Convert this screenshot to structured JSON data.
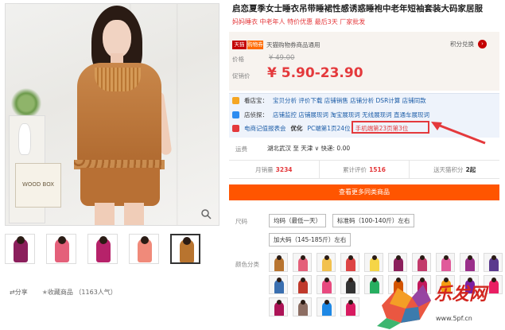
{
  "product": {
    "title": "启恋夏季女士睡衣吊带睡裙性感诱惑睡袍中老年短袖套装大码家居服",
    "subtitle": "妈妈睡衣 中老年人 特价优惠 最后3天 厂家批发",
    "badges": {
      "tmall": "天猫",
      "shopping": "购物券",
      "note": "天猫购物券商品通用"
    },
    "points_link": "积分兑换",
    "price_label": "价格",
    "original_price": "¥ 49.00",
    "promo_label": "促销价",
    "promo_price": "¥ 5.90-23.90"
  },
  "tools": {
    "row1": {
      "lead": "看店宝：",
      "text": "宝贝分析 评价下载 店铺销售 店铺分析 DSR计算 店铺同款"
    },
    "row2": {
      "lead": "店侦探：",
      "text": "店铺监控 店铺展现词 淘宝展现词 无线展现词 直通车展现词"
    },
    "row3": {
      "lead": "电商记值报表会",
      "tag": "优化",
      "pc": "PC端第1页24位",
      "mobile": "手机端第23页第3位"
    }
  },
  "shipping": {
    "label": "运费",
    "text": "湖北武汉 至 天津 ∨ 快递: 0.00"
  },
  "stats": [
    {
      "label": "月销量",
      "value": "3234"
    },
    {
      "label": "累计评价",
      "value": "1516"
    },
    {
      "label": "送天猫积分",
      "value": "2起"
    }
  ],
  "more_button": "查看更多同类商品",
  "size": {
    "label": "尺码",
    "options": [
      "均码（最低一天）",
      "标准码（100-140斤）左右",
      "加大码（145-185斤）左右"
    ]
  },
  "color_label": "颜色分类",
  "share": {
    "share": "分享",
    "favorite": "收藏商品",
    "count": "（1163人气）"
  },
  "watermark": {
    "text": "乐发网",
    "url": "www.5pf.cn"
  },
  "colors": {
    "accent": "#e4393c",
    "button": "#ff5500",
    "dress": "#b8742f"
  },
  "icons": {
    "zoom": "zoom-icon",
    "share": "share-icon",
    "favorite": "star-icon",
    "points": "chevron-right-icon"
  }
}
